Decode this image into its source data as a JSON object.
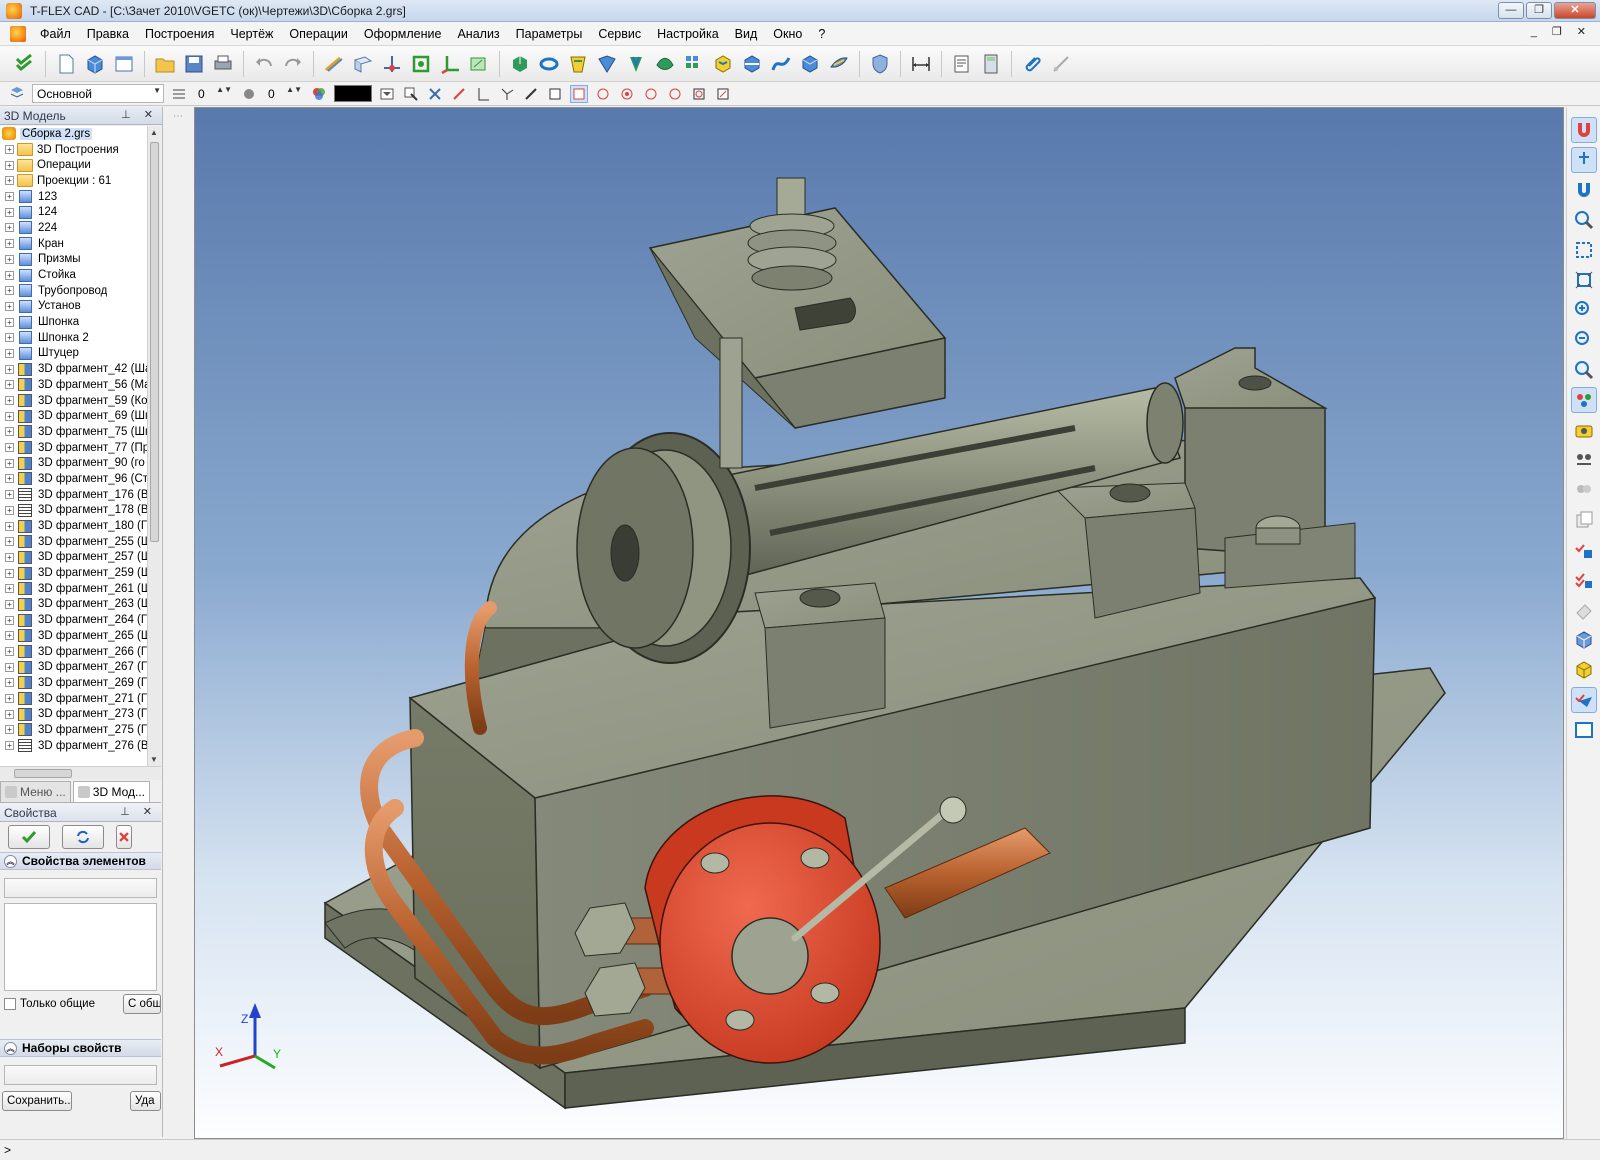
{
  "window": {
    "title": "T-FLEX CAD - [C:\\Зачет 2010\\VGETC (ок)\\Чертежи\\3D\\Сборка 2.grs]",
    "controls": [
      "—",
      "❐",
      "✕"
    ]
  },
  "menu": {
    "items": [
      "Файл",
      "Правка",
      "Построения",
      "Чертёж",
      "Операции",
      "Оформление",
      "Анализ",
      "Параметры",
      "Сервис",
      "Настройка",
      "Вид",
      "Окно",
      "?"
    ],
    "mdi_controls": "_ ❐ ✕"
  },
  "toolbar2": {
    "layer_combo": "Основной",
    "level_value_1": "0",
    "level_value_2": "0",
    "color_value": "#000000"
  },
  "model_panel": {
    "title": "3D Модель",
    "header_buttons": "⊥ ✕",
    "root": "Сборка 2.grs",
    "items": [
      {
        "label": "3D Построения",
        "icon": "folder-icon"
      },
      {
        "label": "Операции",
        "icon": "folder-icon"
      },
      {
        "label": "Проекции : 61",
        "icon": "folder-icon"
      },
      {
        "label": "123",
        "icon": "part-icon"
      },
      {
        "label": "124",
        "icon": "part-icon"
      },
      {
        "label": "224",
        "icon": "part-icon"
      },
      {
        "label": "Кран",
        "icon": "part-icon"
      },
      {
        "label": "Призмы",
        "icon": "part-icon"
      },
      {
        "label": "Стойка",
        "icon": "part-icon"
      },
      {
        "label": "Трубопровод",
        "icon": "part-icon"
      },
      {
        "label": "Установ",
        "icon": "part-icon"
      },
      {
        "label": "Шпонка",
        "icon": "part-icon"
      },
      {
        "label": "Шпонка 2",
        "icon": "part-icon"
      },
      {
        "label": "Штуцер",
        "icon": "part-icon"
      },
      {
        "label": "3D фрагмент_42 (Ша",
        "icon": "fragment-icon"
      },
      {
        "label": "3D фрагмент_56 (Ма",
        "icon": "fragment-icon"
      },
      {
        "label": "3D фрагмент_59 (Ко",
        "icon": "fragment-icon"
      },
      {
        "label": "3D фрагмент_69 (Шп",
        "icon": "fragment-icon"
      },
      {
        "label": "3D фрагмент_75 (Шп",
        "icon": "fragment-icon"
      },
      {
        "label": "3D фрагмент_77 (Пр",
        "icon": "fragment-icon"
      },
      {
        "label": "3D фрагмент_90 (го",
        "icon": "fragment-icon"
      },
      {
        "label": "3D фрагмент_96 (Ст",
        "icon": "fragment-icon"
      },
      {
        "label": "3D фрагмент_176 (В",
        "icon": "bolt-fragment-icon"
      },
      {
        "label": "3D фрагмент_178 (В",
        "icon": "bolt-fragment-icon"
      },
      {
        "label": "3D фрагмент_180 (Г",
        "icon": "fragment-icon"
      },
      {
        "label": "3D фрагмент_255 (Ш",
        "icon": "fragment-icon"
      },
      {
        "label": "3D фрагмент_257 (Ш",
        "icon": "fragment-icon"
      },
      {
        "label": "3D фрагмент_259 (Ш",
        "icon": "fragment-icon"
      },
      {
        "label": "3D фрагмент_261 (Ш",
        "icon": "fragment-icon"
      },
      {
        "label": "3D фрагмент_263 (Ш",
        "icon": "fragment-icon"
      },
      {
        "label": "3D фрагмент_264 (Г",
        "icon": "fragment-icon"
      },
      {
        "label": "3D фрагмент_265 (Ш",
        "icon": "fragment-icon"
      },
      {
        "label": "3D фрагмент_266 (Г",
        "icon": "fragment-icon"
      },
      {
        "label": "3D фрагмент_267 (Г",
        "icon": "fragment-icon"
      },
      {
        "label": "3D фрагмент_269 (Г",
        "icon": "fragment-icon"
      },
      {
        "label": "3D фрагмент_271 (Г",
        "icon": "fragment-icon"
      },
      {
        "label": "3D фрагмент_273 (Г",
        "icon": "fragment-icon"
      },
      {
        "label": "3D фрагмент_275 (Г",
        "icon": "fragment-icon"
      },
      {
        "label": "3D фрагмент_276 (В",
        "icon": "bolt-fragment-icon"
      }
    ]
  },
  "tabs": [
    "Меню ...",
    "3D Мод..."
  ],
  "properties": {
    "title": "Свойства",
    "section_elements": "Свойства элементов",
    "only_common_label": "Только общие",
    "common_button": "С общ",
    "section_sets": "Наборы свойств",
    "save_button": "Сохранить...",
    "delete_button": "Уда"
  },
  "viewport": {
    "axes": {
      "x": "X",
      "y": "Y",
      "z": "Z"
    },
    "colors": {
      "body": "#7e8370",
      "valve": "#e0452c",
      "pipe": "#c0683a",
      "gear": "#8f9580"
    }
  },
  "status": {
    "text": ">"
  }
}
